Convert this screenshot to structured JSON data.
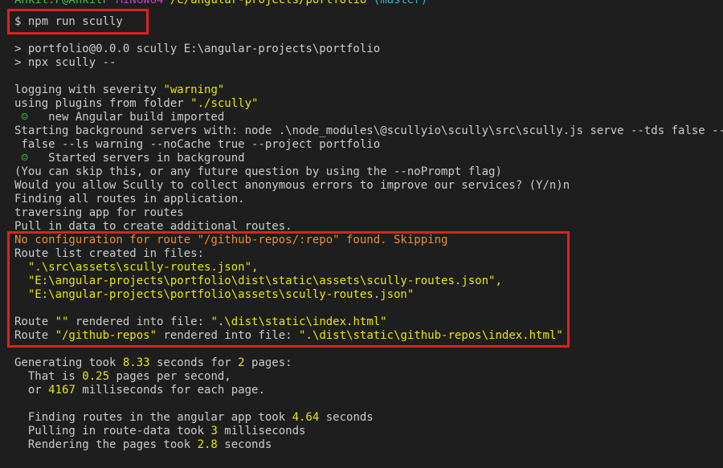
{
  "prompt": {
    "user": "Ankit.P@AnkitP",
    "shell": "MINGW64",
    "path": "/e/angular-projects/portfolio",
    "branch": "(master)"
  },
  "command": "$ npm run scully",
  "output": {
    "l1": "> portfolio@0.0.0 scully E:\\angular-projects\\portfolio",
    "l2": "> npx scully --",
    "l3a": "logging with severity ",
    "l3b": "\"warning\"",
    "l4a": "using plugins from folder ",
    "l4b": "\"./scully\"",
    "l5icon": " ☺",
    "l5": "   new Angular build imported",
    "l6": "Starting background servers with: node .\\node_modules\\@scullyio\\scully\\src\\scully.js serve --tds false --pjf",
    "l7": " false --ls warning --noCache true --project portfolio",
    "l8icon": " ☺",
    "l8": "   Started servers in background",
    "l9": "(You can skip this, or any future question by using the --noPrompt flag)",
    "l10": "Would you allow Scully to collect anonymous errors to improve our services? (Y/n)n",
    "l11": "Finding all routes in application.",
    "l12": "traversing app for routes",
    "l13": "Pull in data to create additional routes.",
    "l14": "No configuration for route \"/github-repos/:repo\" found. Skipping",
    "l15": "Route list created in files:",
    "l16": "  \".\\src\\assets\\scully-routes.json\",",
    "l17": "  \"E:\\angular-projects\\portfolio\\dist\\static\\assets\\scully-routes.json\",",
    "l18": "  \"E:\\angular-projects\\portfolio\\assets\\scully-routes.json\"",
    "l19a": "Route ",
    "l19b": "\"\"",
    "l19c": " rendered into file: ",
    "l19d": "\".\\dist\\static\\index.html\"",
    "l20a": "Route ",
    "l20b": "\"/github-repos\"",
    "l20c": " rendered into file: ",
    "l20d": "\".\\dist\\static\\github-repos\\index.html\"",
    "l21a": "Generating took ",
    "l21b": "8.33",
    "l21c": " seconds for ",
    "l21d": "2",
    "l21e": " pages:",
    "l22a": "  That is ",
    "l22b": "0.25",
    "l22c": " pages per second,",
    "l23a": "  or ",
    "l23b": "4167",
    "l23c": " milliseconds for each page.",
    "l24a": "  Finding routes in the angular app took ",
    "l24b": "4.64",
    "l24c": " seconds",
    "l25a": "  Pulling in route-data took ",
    "l25b": "3",
    "l25c": " milliseconds",
    "l26a": "  Rendering the pages took ",
    "l26b": "2.8",
    "l26c": " seconds"
  },
  "colors": {
    "background": "#1e1e1e",
    "text": "#cccccc",
    "highlight_box": "#e02020",
    "yellow": "#e5e510",
    "orange": "#f0883e"
  }
}
